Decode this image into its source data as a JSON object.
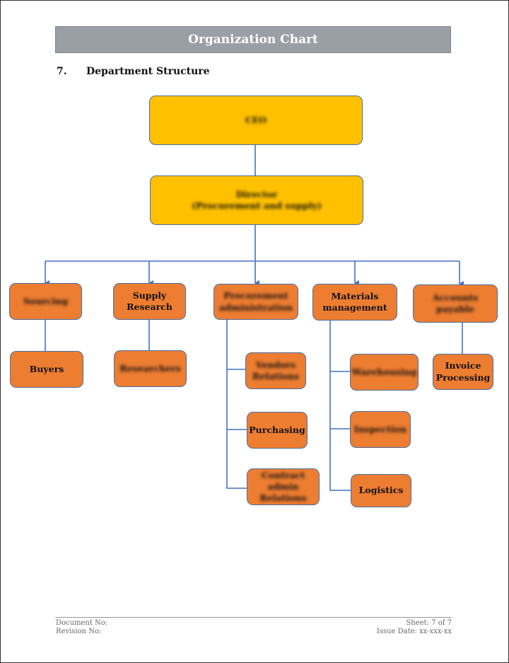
{
  "header": {
    "title": "Organization Chart"
  },
  "section": {
    "number": "7.",
    "title": "Department Structure"
  },
  "chart": {
    "colors": {
      "executive": "#ffc000",
      "department": "#ed7d31",
      "connector": "#4472c4"
    },
    "ceo": {
      "label": "CEO",
      "blurred": true
    },
    "director": {
      "label": "Director\n(Procurement and supply)",
      "blurred": true
    },
    "departments": [
      {
        "label": "Sourcing",
        "blurred": true,
        "children": [
          {
            "label": "Buyers",
            "blurred": false
          }
        ]
      },
      {
        "label": "Supply Research",
        "blurred": false,
        "children": [
          {
            "label": "Researchers",
            "blurred": true
          }
        ]
      },
      {
        "label": "Procurement administration",
        "blurred": true,
        "children": [
          {
            "label": "Vendors Relations",
            "blurred": true
          },
          {
            "label": "Purchasing",
            "blurred": false
          },
          {
            "label": "Contract admin Relations",
            "blurred": true
          }
        ]
      },
      {
        "label": "Materials management",
        "blurred": false,
        "children": [
          {
            "label": "Warehousing",
            "blurred": true
          },
          {
            "label": "Inspection",
            "blurred": true
          },
          {
            "label": "Logistics",
            "blurred": false
          }
        ]
      },
      {
        "label": "Accounts payable",
        "blurred": true,
        "children": [
          {
            "label": "Invoice Processing",
            "blurred": false
          }
        ]
      }
    ]
  },
  "footer": {
    "document_no": "Document No:",
    "revision_no": "Revision No:",
    "sheet": "Sheet: 7 of 7",
    "issue_date": "Issue Date: xx-xxx-xx"
  }
}
